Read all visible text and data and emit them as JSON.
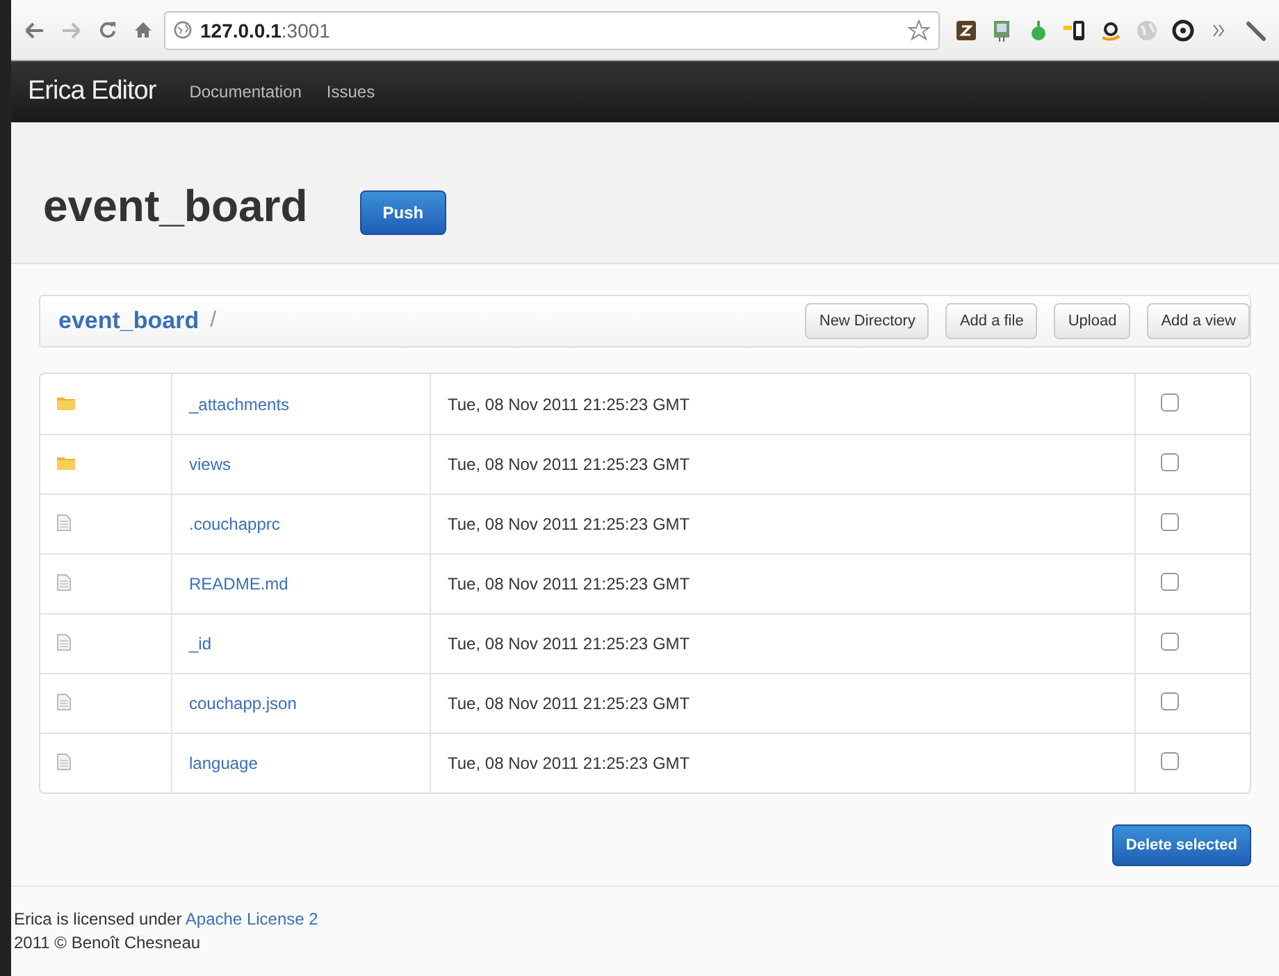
{
  "browser": {
    "address_host": "127.0.0.1",
    "address_port": ":3001"
  },
  "navbar": {
    "brand": "Erica Editor",
    "links": [
      "Documentation",
      "Issues"
    ]
  },
  "header": {
    "title": "event_board",
    "push_button": "Push"
  },
  "breadcrumb": {
    "link": "event_board",
    "separator": "/"
  },
  "actions": [
    "New Directory",
    "Add a file",
    "Upload",
    "Add a view"
  ],
  "files": [
    {
      "kind": "folder",
      "name": "_attachments",
      "modified": "Tue, 08 Nov 2011 21:25:23 GMT",
      "checked": false
    },
    {
      "kind": "folder",
      "name": "views",
      "modified": "Tue, 08 Nov 2011 21:25:23 GMT",
      "checked": false
    },
    {
      "kind": "file",
      "name": ".couchapprc",
      "modified": "Tue, 08 Nov 2011 21:25:23 GMT",
      "checked": false
    },
    {
      "kind": "file",
      "name": "README.md",
      "modified": "Tue, 08 Nov 2011 21:25:23 GMT",
      "checked": false
    },
    {
      "kind": "file",
      "name": "_id",
      "modified": "Tue, 08 Nov 2011 21:25:23 GMT",
      "checked": false
    },
    {
      "kind": "file",
      "name": "couchapp.json",
      "modified": "Tue, 08 Nov 2011 21:25:23 GMT",
      "checked": false
    },
    {
      "kind": "file",
      "name": "language",
      "modified": "Tue, 08 Nov 2011 21:25:23 GMT",
      "checked": false
    }
  ],
  "delete_button": "Delete selected",
  "footer": {
    "license_text": "Erica is licensed under",
    "license_link": "Apache License 2",
    "copyright": "2011 © Benoît Chesneau"
  }
}
